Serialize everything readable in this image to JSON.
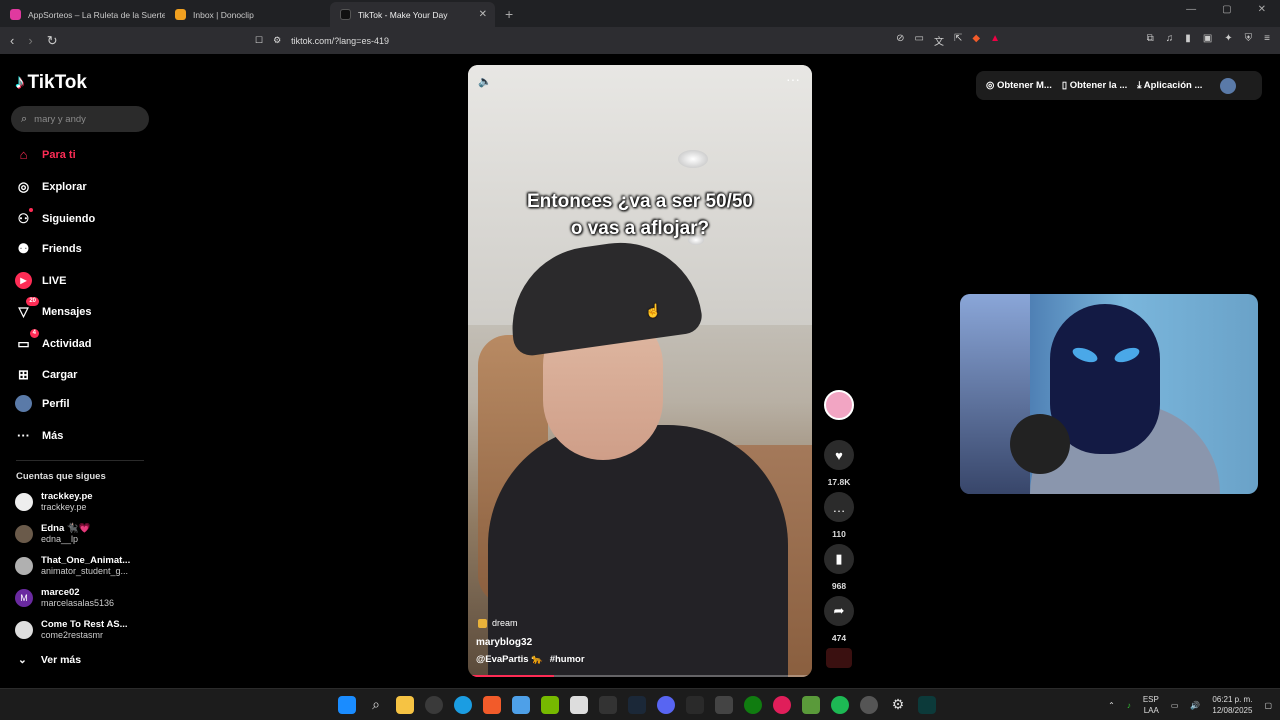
{
  "browser": {
    "tabs": [
      {
        "title": "AppSorteos – La Ruleta de la Suerte",
        "color": "#e0399f",
        "active": false
      },
      {
        "title": "Inbox | Donoclip",
        "color": "#f0a020",
        "active": false
      },
      {
        "title": "TikTok - Make Your Day",
        "color": "#111111",
        "active": true
      }
    ],
    "new_tab": "+",
    "url": "tiktok.com/?lang=es-419"
  },
  "sidebar": {
    "logo": "TikTok",
    "search_placeholder": "mary y andy",
    "menu": [
      {
        "label": "Para ti",
        "icon": "home-icon",
        "active": true
      },
      {
        "label": "Explorar",
        "icon": "compass-icon"
      },
      {
        "label": "Siguiendo",
        "icon": "following-icon"
      },
      {
        "label": "Friends",
        "icon": "friends-icon"
      },
      {
        "label": "LIVE",
        "icon": "live-icon"
      },
      {
        "label": "Mensajes",
        "icon": "messages-icon",
        "badge": "20"
      },
      {
        "label": "Actividad",
        "icon": "activity-icon",
        "badge": "4"
      },
      {
        "label": "Cargar",
        "icon": "upload-icon"
      },
      {
        "label": "Perfil",
        "icon": "profile-icon"
      },
      {
        "label": "Más",
        "icon": "more-icon"
      }
    ],
    "following_title": "Cuentas que sigues",
    "following": [
      {
        "name": "trackkey.pe",
        "handle": "trackkey.pe",
        "color": "#eeeeee"
      },
      {
        "name": "Edna 🐈‍⬛💗",
        "handle": "edna__lp",
        "color": "#6a5a4a"
      },
      {
        "name": "That_One_Animat...",
        "handle": "animator_student_g...",
        "color": "#b0b0b0"
      },
      {
        "name": "marce02",
        "handle": "marcelasalas5136",
        "color": "#6a2aa0"
      },
      {
        "name": "Come To Rest AS...",
        "handle": "come2restasmr",
        "color": "#dddddd"
      }
    ],
    "see_more": "Ver más"
  },
  "video": {
    "caption_line1": "Entonces ¿va a ser 50/50",
    "caption_line2": "o vas a aflojar?",
    "tag": "dream",
    "username": "maryblog32",
    "mention": "@EvaPartis 🐆",
    "hashtag": "#humor",
    "progress": 0.25
  },
  "actions": {
    "likes": "17.8K",
    "comments": "110",
    "saves": "968",
    "shares": "474"
  },
  "top_right": {
    "btn1": "Obtener M...",
    "btn2": "Obtener la ...",
    "btn3": "Aplicación ..."
  },
  "tray": {
    "lang": "ESP",
    "layout": "LAA",
    "time": "06:21 p. m.",
    "date": "12/08/2025"
  }
}
